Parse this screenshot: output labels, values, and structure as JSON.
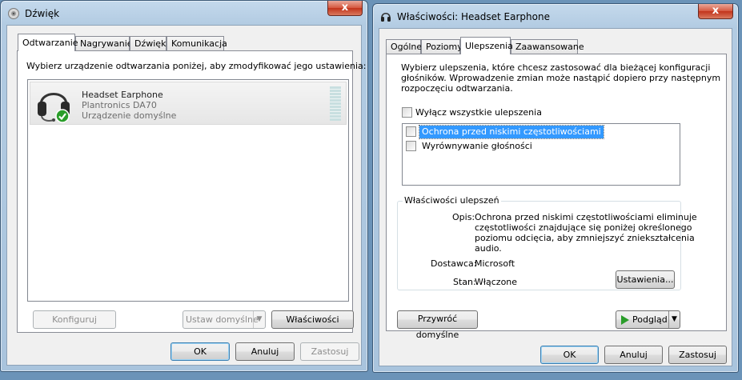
{
  "sound_window": {
    "title": "Dźwięk",
    "close_label": "x",
    "tabs": [
      "Odtwarzanie",
      "Nagrywanie",
      "Dźwięki",
      "Komunikacja"
    ],
    "instruction": "Wybierz urządzenie odtwarzania poniżej, aby zmodyfikować jego ustawienia:",
    "device": {
      "name": "Headset Earphone",
      "model": "Plantronics DA70",
      "status": "Urządzenie domyślne"
    },
    "configure_button": "Konfiguruj",
    "set_default_button": "Ustaw domyślne",
    "properties_button": "Właściwości",
    "ok_button": "OK",
    "cancel_button": "Anuluj",
    "apply_button": "Zastosuj"
  },
  "props_window": {
    "title": "Właściwości: Headset Earphone",
    "close_label": "x",
    "tabs": [
      "Ogólne",
      "Poziomy",
      "Ulepszenia",
      "Zaawansowane"
    ],
    "description_line1": "Wybierz ulepszenia, które chcesz zastosować dla bieżącej konfiguracji",
    "description_line2": "głośników. Wprowadzenie zmian może nastąpić dopiero przy następnym",
    "description_line3": "rozpoczęciu odtwarzania.",
    "disable_all_label": "Wyłącz wszystkie ulepszenia",
    "enhancements": [
      {
        "label": "Ochrona przed niskimi częstotliwościami",
        "selected": true
      },
      {
        "label": "Wyrównywanie głośności",
        "selected": false
      }
    ],
    "group_title": "Właściwości ulepszeń",
    "description_label": "Opis:",
    "description_value_1": "Ochrona przed niskimi częstotliwościami eliminuje",
    "description_value_2": "częstotliwości znajdujące się poniżej określonego",
    "description_value_3": "poziomu odcięcia, aby zmniejszyć zniekształcenia",
    "description_value_4": "audio.",
    "provider_label": "Dostawca:",
    "provider_value": "Microsoft",
    "state_label": "Stan:",
    "state_value": "Włączone",
    "settings_button": "Ustawienia...",
    "restore_defaults_button": "Przywróć domyślne",
    "preview_button": "Podgląd",
    "ok_button": "OK",
    "cancel_button": "Anuluj",
    "apply_button": "Zastosuj"
  },
  "colors": {
    "selection": "#3399ff",
    "desktop": "#6b93b8",
    "check_green": "#2a9d2a"
  }
}
